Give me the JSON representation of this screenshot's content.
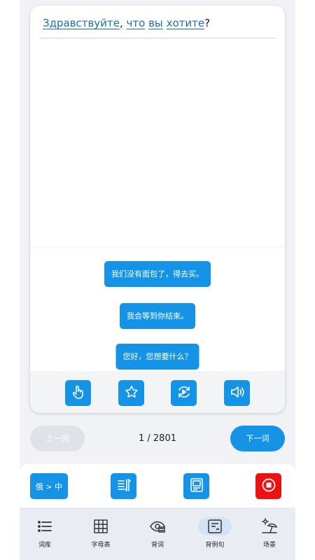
{
  "sentence": {
    "words": [
      "Здравствуйте",
      "что",
      "вы",
      "хотите"
    ],
    "punct": [
      ",",
      "",
      "",
      "?"
    ]
  },
  "answers": [
    "我们没有面包了，得去买。",
    "我会等到你结束。",
    "您好，您想要什么？"
  ],
  "tools": [
    "tap-icon",
    "star-icon",
    "replay-icon",
    "speaker-icon"
  ],
  "pager": {
    "prev_label": "上一词",
    "counter": "1 / 2801",
    "next_label": "下一词"
  },
  "actions": {
    "translate_label": "俄 > 中",
    "sort_icon": "sort-icon",
    "flashcard_icon": "flashcard-icon",
    "stop_icon": "stop-icon"
  },
  "tabs": [
    {
      "label": "词库",
      "icon": "list-icon"
    },
    {
      "label": "字母表",
      "icon": "grid-icon"
    },
    {
      "label": "背词",
      "icon": "eye-icon"
    },
    {
      "label": "背例句",
      "icon": "sentence-icon",
      "active": true
    },
    {
      "label": "场景",
      "icon": "beach-icon"
    }
  ],
  "colors": {
    "accent": "#1593e6",
    "stop": "#ee1111",
    "disabled": "#dfe2e6"
  }
}
